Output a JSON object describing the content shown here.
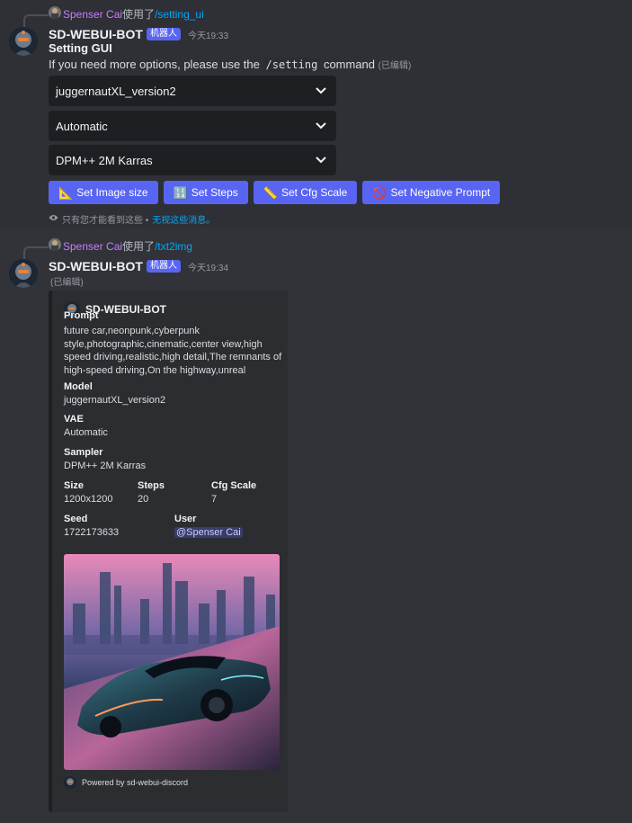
{
  "messages": [
    {
      "reply": {
        "user": "Spenser Cai",
        "action": "使用了",
        "command": "/setting_ui"
      },
      "author": "SD-WEBUI-BOT",
      "badge": "机器人",
      "timestamp": "今天19:33",
      "title": "Setting GUI",
      "body_prefix": "If you need more options, please use the",
      "body_code": "/setting",
      "body_suffix": "command",
      "edited": "(已编辑)",
      "selects": [
        {
          "value": "juggernautXL_version2"
        },
        {
          "value": "Automatic"
        },
        {
          "value": "DPM++ 2M Karras"
        }
      ],
      "buttons": [
        {
          "icon": "📐",
          "icon_name": "triangular-ruler-icon",
          "label": "Set Image size"
        },
        {
          "icon": "🔢",
          "icon_name": "input-numbers-icon",
          "label": "Set Steps"
        },
        {
          "icon": "📏",
          "icon_name": "straight-ruler-icon",
          "label": "Set Cfg Scale"
        },
        {
          "icon": "🚫",
          "icon_name": "prohibited-icon",
          "label": "Set Negative Prompt"
        }
      ],
      "ephemeral_text": "只有您才能看到这些 •",
      "ephemeral_link": "无视这些消息。"
    },
    {
      "reply": {
        "user": "Spenser Cai",
        "action": "使用了",
        "command": "/txt2img"
      },
      "author": "SD-WEBUI-BOT",
      "badge": "机器人",
      "timestamp": "今天19:34",
      "edited": "(已编辑)",
      "embed": {
        "author": "SD-WEBUI-BOT",
        "prompt_label": "Prompt",
        "prompt_lines": [
          "future car,neonpunk,cyberpunk",
          "style,photographic,cinematic,center view,high",
          "speed driving,realistic,high detail,The remnants of",
          "high-speed driving,On the highway,unreal"
        ],
        "model_label": "Model",
        "model": "juggernautXL_version2",
        "vae_label": "VAE",
        "vae": "Automatic",
        "sampler_label": "Sampler",
        "sampler": "DPM++ 2M Karras",
        "size_label": "Size",
        "size": "1200x1200",
        "steps_label": "Steps",
        "steps": "20",
        "cfg_label": "Cfg Scale",
        "cfg": "7",
        "seed_label": "Seed",
        "seed": "1722173633",
        "user_label": "User",
        "user": "@Spenser Cai",
        "footer": "Powered by sd-webui-discord"
      }
    }
  ],
  "colors": {
    "background": "#313338",
    "highlight_message": "#2e3035",
    "blurple": "#5865f2",
    "link": "#00a8fc",
    "reply_name": "#c77dff",
    "select_bg": "#1e1f22",
    "embed_bg": "#2b2d31"
  }
}
